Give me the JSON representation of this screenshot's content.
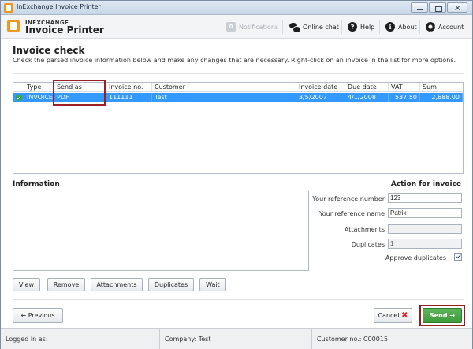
{
  "window": {
    "title": "InExchange Invoice Printer"
  },
  "header": {
    "brand_small": "INEXCHANGE",
    "brand_big": "Invoice Printer",
    "notifications_count": "0",
    "notifications_label": "Notifications",
    "chat_label": "Online chat",
    "help_label": "Help",
    "about_label": "About",
    "account_label": "Account"
  },
  "page": {
    "title": "Invoice check",
    "description": "Check the parsed invoice information below and make any changes that are necessary. Right-click on an invoice in the list for more options."
  },
  "table": {
    "columns": [
      "Type",
      "Send as",
      "Invoice no.",
      "Customer",
      "Invoice date",
      "Due date",
      "VAT",
      "Sum"
    ],
    "rows": [
      {
        "type": "INVOICE",
        "send_as": "PDF",
        "invoice_no": "111111",
        "customer": "Test",
        "invoice_date": "3/5/2007",
        "due_date": "4/1/2008",
        "vat": "537.50",
        "sum": "2,688.00",
        "selected": true,
        "status": "ok"
      }
    ]
  },
  "information": {
    "title": "Information"
  },
  "action": {
    "title": "Action for invoice",
    "your_reference_number_label": "Your reference number",
    "your_reference_number": "123",
    "your_reference_name_label": "Your reference name",
    "your_reference_name": "Patrik",
    "attachments_label": "Attachments",
    "attachments": "",
    "duplicates_label": "Duplicates",
    "duplicates": "1",
    "approve_duplicates_label": "Approve duplicates",
    "approve_duplicates": true
  },
  "buttons": {
    "view": "View",
    "remove": "Remove",
    "attachments": "Attachments",
    "duplicates": "Duplicates",
    "wait": "Wait",
    "previous": "Previous",
    "cancel": "Cancel",
    "send": "Send"
  },
  "status": {
    "logged_in": "Logged in as:",
    "company": "Company: Test",
    "customer_no": "Customer no.: C00015"
  },
  "colors": {
    "selection": "#3399ff",
    "send_button": "#4aa648",
    "highlight_border": "#9c1f25",
    "brand_orange": "#ee9a22"
  }
}
